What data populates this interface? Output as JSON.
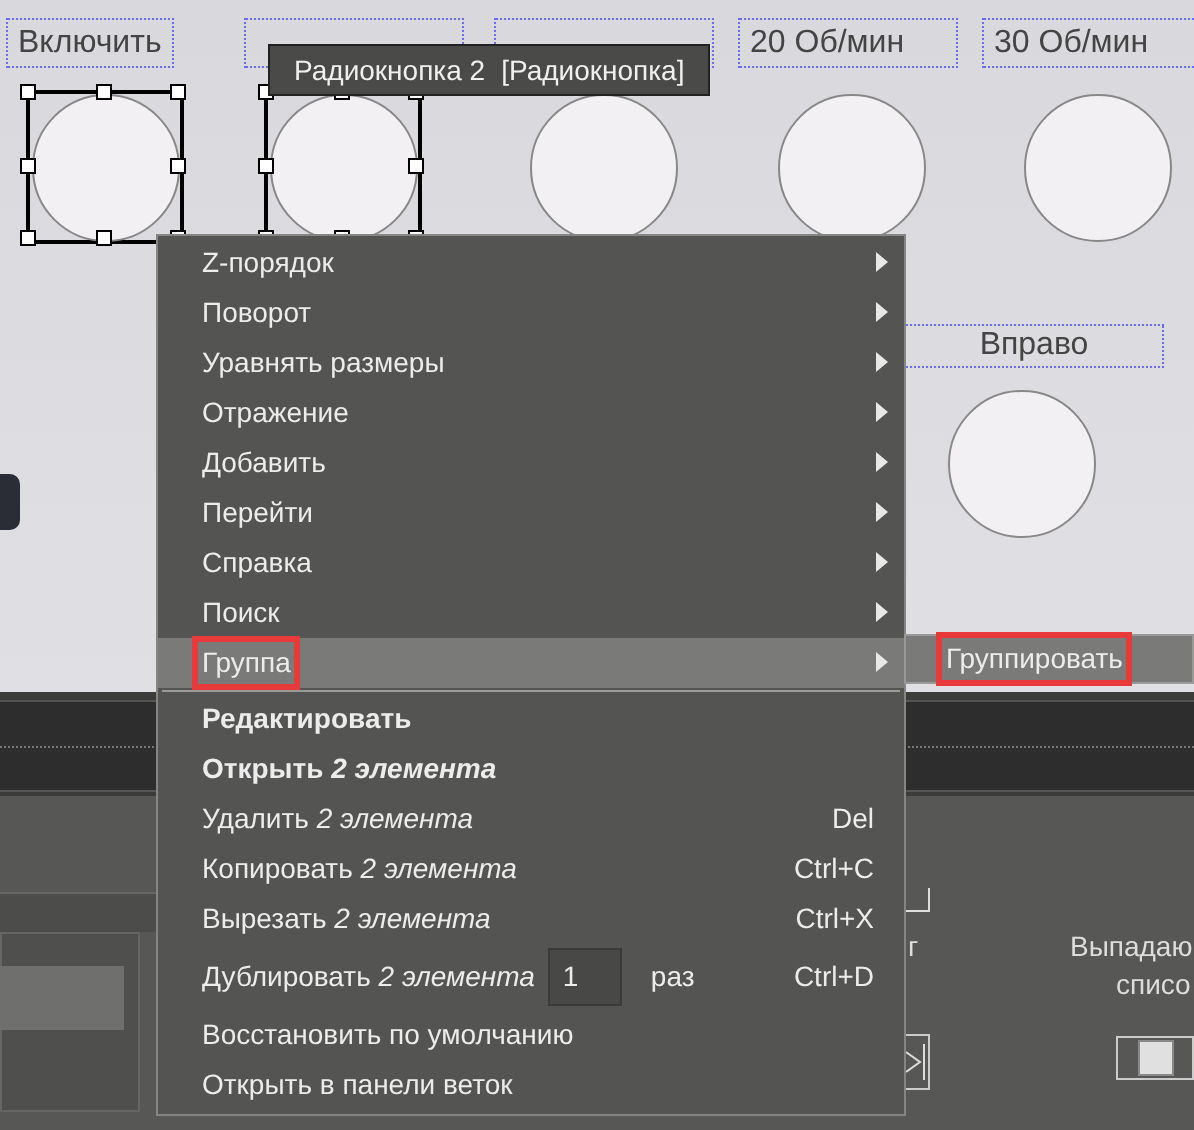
{
  "canvas": {
    "labels": [
      {
        "text": "Включить"
      },
      {
        "covered": true
      },
      {
        "covered": true
      },
      {
        "text": "20 Об/мин"
      },
      {
        "text": "30 Об/мин"
      }
    ],
    "radio_buttons": [
      {
        "selected": true
      },
      {
        "selected": true
      },
      {
        "selected": false
      },
      {
        "selected": false
      },
      {
        "selected": false
      }
    ],
    "right_label": "Вправо",
    "right_radio": {
      "selected": false
    },
    "tooltip": {
      "name": "Радиокнопка 2",
      "type": "[Радиокнопка]"
    }
  },
  "context_menu": {
    "items": [
      {
        "kind": "submenu",
        "label": "Z-порядок",
        "highlighted": false,
        "outlined": false
      },
      {
        "kind": "submenu",
        "label": "Поворот",
        "highlighted": false,
        "outlined": false
      },
      {
        "kind": "submenu",
        "label": "Уравнять размеры",
        "highlighted": false,
        "outlined": false
      },
      {
        "kind": "submenu",
        "label": "Отражение",
        "highlighted": false,
        "outlined": false
      },
      {
        "kind": "submenu",
        "label": "Добавить",
        "highlighted": false,
        "outlined": false
      },
      {
        "kind": "submenu",
        "label": "Перейти",
        "highlighted": false,
        "outlined": false
      },
      {
        "kind": "submenu",
        "label": "Справка",
        "highlighted": false,
        "outlined": false
      },
      {
        "kind": "submenu",
        "label": "Поиск",
        "highlighted": false,
        "outlined": false
      },
      {
        "kind": "submenu",
        "label": "Группа",
        "highlighted": true,
        "outlined": true
      },
      {
        "kind": "separator"
      },
      {
        "kind": "command",
        "label": "Редактировать",
        "bold": true
      },
      {
        "kind": "command",
        "label": "Открыть *2 элемента*",
        "bold": true
      },
      {
        "kind": "command",
        "label": "Удалить *2 элемента*",
        "bold": false,
        "shortcut": "Del"
      },
      {
        "kind": "command",
        "label": "Копировать *2 элемента*",
        "bold": false,
        "shortcut": "Ctrl+C"
      },
      {
        "kind": "command",
        "label": "Вырезать *2 элемента*",
        "bold": false,
        "shortcut": "Ctrl+X"
      },
      {
        "kind": "duplicate",
        "label": "Дублировать *2 элемента*",
        "count": "1",
        "unit": "раз",
        "shortcut": "Ctrl+D"
      },
      {
        "kind": "command",
        "label": "Восстановить по умолчанию",
        "bold": false
      },
      {
        "kind": "command",
        "label": "Открыть в панели веток",
        "bold": false
      }
    ]
  },
  "submenu": {
    "label": "Группировать",
    "highlighted": true,
    "outlined": true
  },
  "bottom_panel": {
    "texts": [
      "г",
      "Выпадаю",
      "списо"
    ],
    "toggle": {
      "on": true
    }
  }
}
